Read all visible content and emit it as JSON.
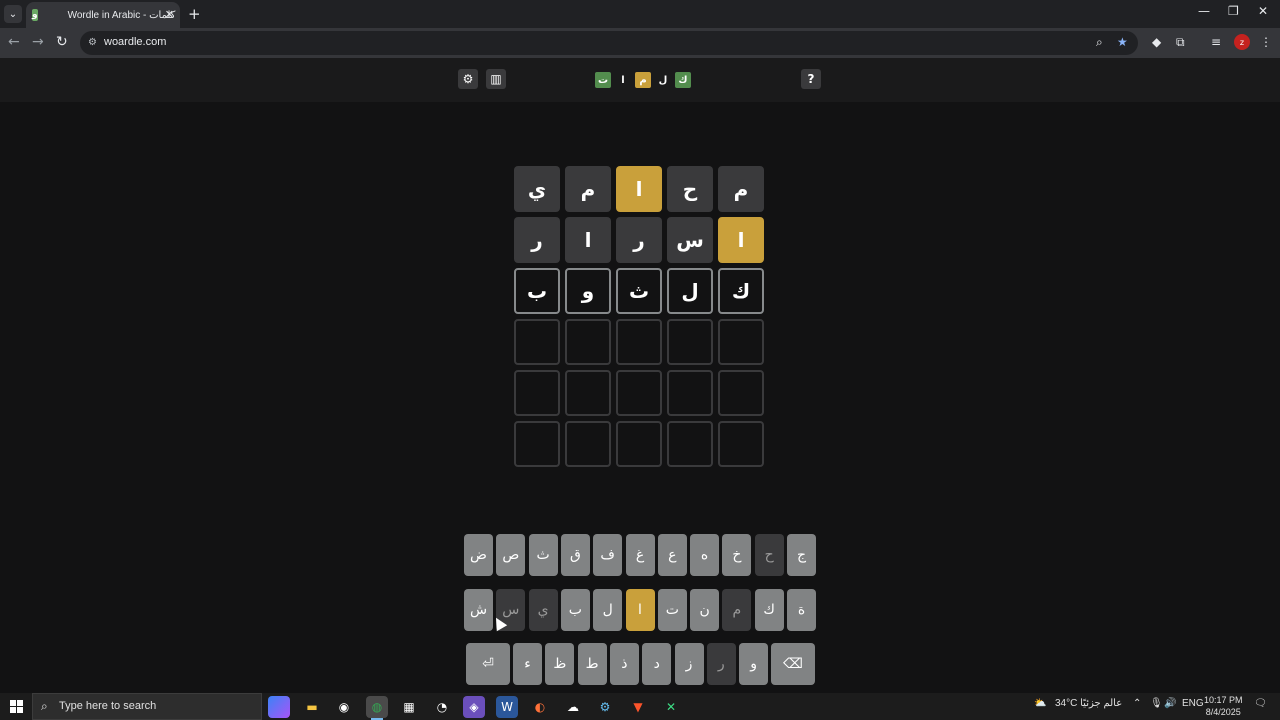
{
  "browser": {
    "tab_title": "Wordle in Arabic - كلمات",
    "favicon_letter": "و",
    "url": "woardle.com"
  },
  "game": {
    "help_label": "?",
    "logo_letters": [
      {
        "ch": "ت",
        "state": "correct"
      },
      {
        "ch": "ا",
        "state": "plain"
      },
      {
        "ch": "م",
        "state": "present"
      },
      {
        "ch": "ل",
        "state": "plain"
      },
      {
        "ch": "ك",
        "state": "correct"
      }
    ],
    "board": [
      [
        {
          "ch": "ي",
          "state": "absent"
        },
        {
          "ch": "م",
          "state": "absent"
        },
        {
          "ch": "ا",
          "state": "present"
        },
        {
          "ch": "ح",
          "state": "absent"
        },
        {
          "ch": "م",
          "state": "absent"
        }
      ],
      [
        {
          "ch": "ر",
          "state": "absent"
        },
        {
          "ch": "ا",
          "state": "absent"
        },
        {
          "ch": "ر",
          "state": "absent"
        },
        {
          "ch": "س",
          "state": "absent"
        },
        {
          "ch": "ا",
          "state": "present"
        }
      ],
      [
        {
          "ch": "ب",
          "state": "tbd"
        },
        {
          "ch": "و",
          "state": "tbd"
        },
        {
          "ch": "ث",
          "state": "tbd"
        },
        {
          "ch": "ل",
          "state": "tbd"
        },
        {
          "ch": "ك",
          "state": "tbd"
        }
      ],
      [
        {
          "ch": "",
          "state": "empty"
        },
        {
          "ch": "",
          "state": "empty"
        },
        {
          "ch": "",
          "state": "empty"
        },
        {
          "ch": "",
          "state": "empty"
        },
        {
          "ch": "",
          "state": "empty"
        }
      ],
      [
        {
          "ch": "",
          "state": "empty"
        },
        {
          "ch": "",
          "state": "empty"
        },
        {
          "ch": "",
          "state": "empty"
        },
        {
          "ch": "",
          "state": "empty"
        },
        {
          "ch": "",
          "state": "empty"
        }
      ],
      [
        {
          "ch": "",
          "state": "empty"
        },
        {
          "ch": "",
          "state": "empty"
        },
        {
          "ch": "",
          "state": "empty"
        },
        {
          "ch": "",
          "state": "empty"
        },
        {
          "ch": "",
          "state": "empty"
        }
      ]
    ],
    "keyboard": [
      [
        {
          "ch": "ض",
          "state": "unused"
        },
        {
          "ch": "ص",
          "state": "unused"
        },
        {
          "ch": "ث",
          "state": "unused"
        },
        {
          "ch": "ق",
          "state": "unused"
        },
        {
          "ch": "ف",
          "state": "unused"
        },
        {
          "ch": "غ",
          "state": "unused"
        },
        {
          "ch": "ع",
          "state": "unused"
        },
        {
          "ch": "ه",
          "state": "unused"
        },
        {
          "ch": "خ",
          "state": "unused"
        },
        {
          "ch": "ح",
          "state": "absent"
        },
        {
          "ch": "ج",
          "state": "unused"
        }
      ],
      [
        {
          "ch": "ش",
          "state": "unused"
        },
        {
          "ch": "س",
          "state": "absent"
        },
        {
          "ch": "ي",
          "state": "absent"
        },
        {
          "ch": "ب",
          "state": "unused"
        },
        {
          "ch": "ل",
          "state": "unused"
        },
        {
          "ch": "ا",
          "state": "present"
        },
        {
          "ch": "ت",
          "state": "unused"
        },
        {
          "ch": "ن",
          "state": "unused"
        },
        {
          "ch": "م",
          "state": "absent"
        },
        {
          "ch": "ك",
          "state": "unused"
        },
        {
          "ch": "ة",
          "state": "unused"
        }
      ],
      [
        {
          "ch": "⏎",
          "state": "unused",
          "role": "enter"
        },
        {
          "ch": "ء",
          "state": "unused"
        },
        {
          "ch": "ظ",
          "state": "unused"
        },
        {
          "ch": "ط",
          "state": "unused"
        },
        {
          "ch": "ذ",
          "state": "unused"
        },
        {
          "ch": "د",
          "state": "unused"
        },
        {
          "ch": "ز",
          "state": "unused"
        },
        {
          "ch": "ر",
          "state": "absent"
        },
        {
          "ch": "و",
          "state": "unused"
        },
        {
          "ch": "⌫",
          "state": "unused",
          "role": "backspace"
        }
      ]
    ]
  },
  "taskbar": {
    "search_placeholder": "Type here to search",
    "weather": "34°C  عالم جزئيًا",
    "language": "ENG",
    "time": "10:17 PM",
    "date": "8/4/2025"
  },
  "colors": {
    "correct": "#538d4e",
    "present": "#c9a03b",
    "absent": "#3a3a3c",
    "key_unused": "#818384"
  }
}
